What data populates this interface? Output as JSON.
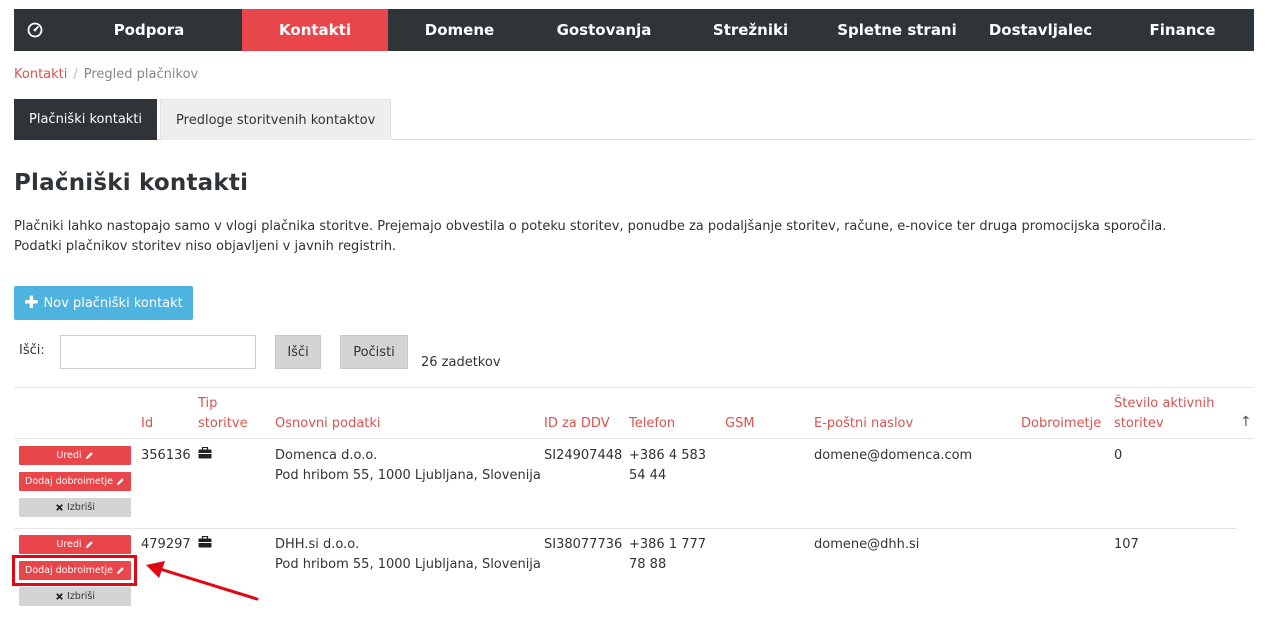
{
  "nav": {
    "items": [
      {
        "label": "Podpora"
      },
      {
        "label": "Kontakti"
      },
      {
        "label": "Domene"
      },
      {
        "label": "Gostovanja"
      },
      {
        "label": "Strežniki"
      },
      {
        "label": "Spletne strani"
      },
      {
        "label": "Dostavljalec"
      },
      {
        "label": "Finance"
      }
    ],
    "active_index": 1,
    "active_color": "#e8464b",
    "bar_color": "#2f3438"
  },
  "breadcrumb": {
    "root": "Kontakti",
    "separator": "/",
    "current": "Pregled plačnikov"
  },
  "tabs": [
    {
      "label": "Plačniški kontakti"
    },
    {
      "label": "Predloge storitvenih kontaktov"
    }
  ],
  "page": {
    "title": "Plačniški kontakti",
    "description_line1": "Plačniki lahko nastopajo samo v vlogi plačnika storitve. Prejemajo obvestila o poteku storitev, ponudbe za podaljšanje storitev, račune, e-novice ter druga promocijska sporočila.",
    "description_line2": "Podatki plačnikov storitev niso objavljeni v javnih registrih."
  },
  "actions": {
    "new_contact": "Nov plačniški kontakt",
    "new_icon": "plus-icon"
  },
  "search": {
    "label": "Išči:",
    "value": "",
    "search_button": "Išči",
    "reset_button": "Počisti",
    "result_count": "26 zadetkov"
  },
  "table": {
    "headers": {
      "id": "Id",
      "type_line1": "Tip",
      "type_line2": "storitve",
      "basic": "Osnovni podatki",
      "vat": "ID za DDV",
      "phone": "Telefon",
      "gsm": "GSM",
      "email": "E-poštni naslov",
      "credit": "Dobroimetje",
      "active_line1": "Število aktivnih",
      "active_line2": "storitev",
      "sort_indicator": "↑"
    },
    "row_buttons": {
      "edit": "Uredi",
      "add_credit": "Dodaj dobroimetje",
      "delete": "Izbriši"
    },
    "rows": [
      {
        "id": "356136",
        "type_icon": "briefcase-icon",
        "name": "Domenca d.o.o.",
        "address": "Pod hribom 55, 1000 Ljubljana, Slovenija",
        "vat": "SI24907448",
        "phone_line1": "+386 4 583",
        "phone_line2": "54 44",
        "gsm": "",
        "email": "domene@domenca.com",
        "credit": "",
        "active": "0"
      },
      {
        "id": "479297",
        "type_icon": "briefcase-icon",
        "name": "DHH.si d.o.o.",
        "address": "Pod hribom 55, 1000 Ljubljana, Slovenija",
        "vat": "SI38077736",
        "phone_line1": "+386 1 777",
        "phone_line2": "78 88",
        "gsm": "",
        "email": "domene@dhh.si",
        "credit": "",
        "active": "107"
      }
    ]
  },
  "annotation": {
    "highlight_color": "#e30613"
  }
}
